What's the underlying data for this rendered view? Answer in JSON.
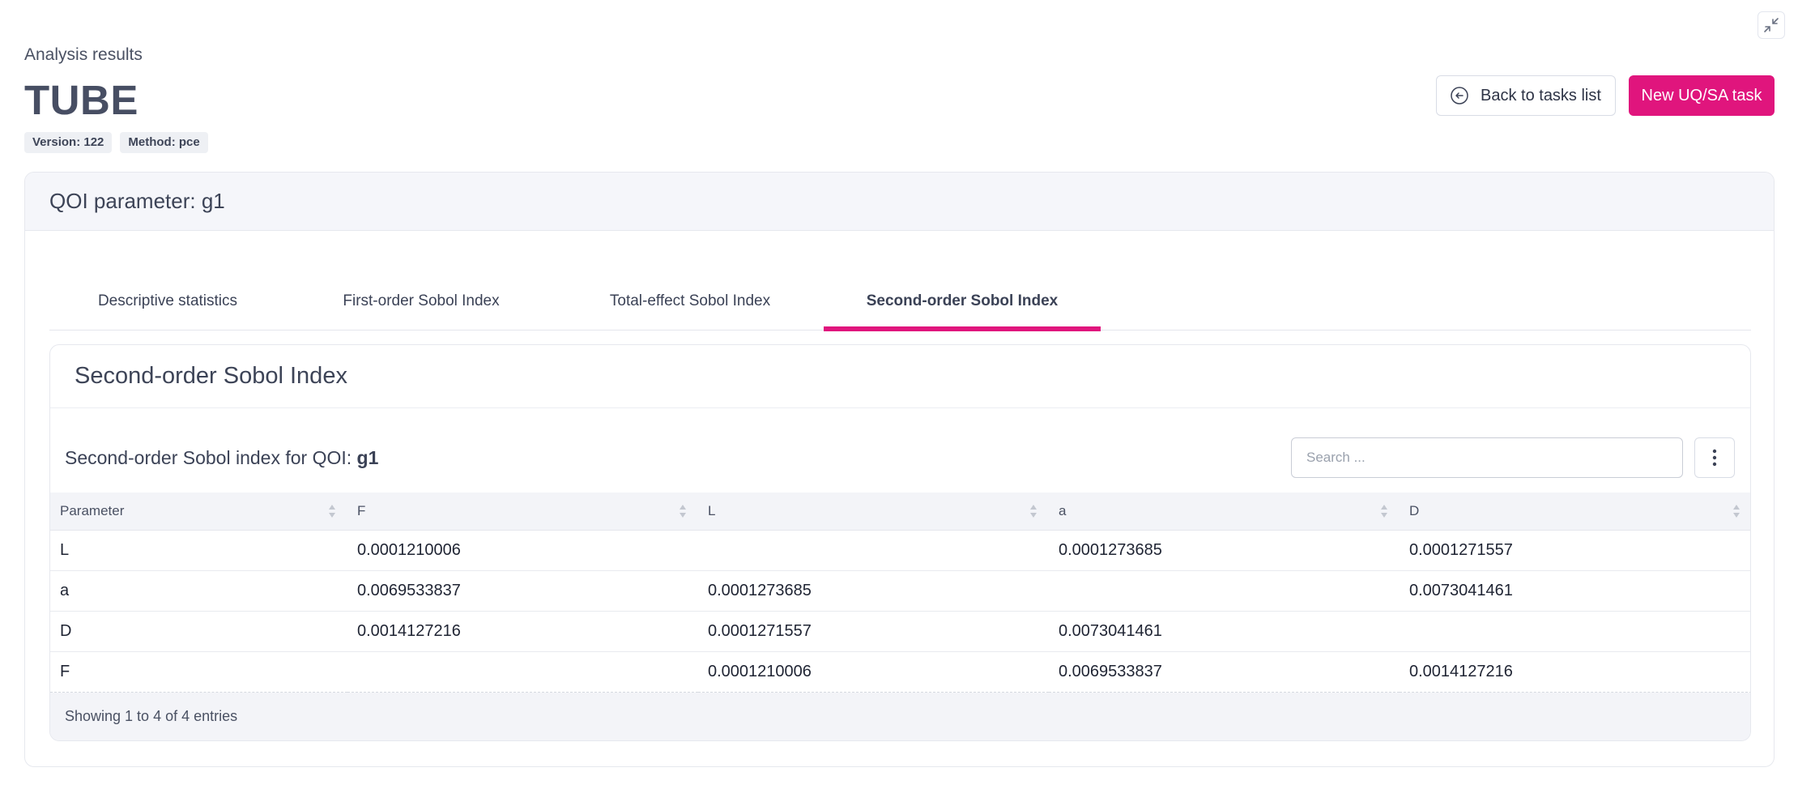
{
  "header": {
    "subtitle": "Analysis results",
    "title": "TUBE",
    "badges": {
      "version": "Version: 122",
      "method": "Method: pce"
    },
    "back_button": "Back to tasks list",
    "new_task_button": "New UQ/SA task"
  },
  "card": {
    "title": "QOI parameter: g1",
    "tabs": [
      {
        "label": "Descriptive statistics",
        "active": false
      },
      {
        "label": "First-order Sobol Index",
        "active": false
      },
      {
        "label": "Total-effect Sobol Index",
        "active": false
      },
      {
        "label": "Second-order Sobol Index",
        "active": true
      }
    ],
    "section_title": "Second-order Sobol Index",
    "table_caption": {
      "prefix": "Second-order Sobol index for QOI: ",
      "qoi": "g1"
    },
    "search_placeholder": "Search ...",
    "table": {
      "columns": [
        "Parameter",
        "F",
        "L",
        "a",
        "D"
      ],
      "rows": [
        [
          "L",
          "0.0001210006",
          "",
          "0.0001273685",
          "0.0001271557"
        ],
        [
          "a",
          "0.0069533837",
          "0.0001273685",
          "",
          "0.0073041461"
        ],
        [
          "D",
          "0.0014127216",
          "0.0001271557",
          "0.0073041461",
          ""
        ],
        [
          "F",
          "",
          "0.0001210006",
          "0.0069533837",
          "0.0014127216"
        ]
      ]
    },
    "footer": "Showing 1 to 4 of 4 entries"
  },
  "colors": {
    "accent": "#e0157d",
    "text": "#3b4256",
    "header_bg": "#f5f6fa"
  },
  "icons": {
    "collapse": "collapse-icon",
    "back": "arrow-left-circle-icon",
    "more": "more-vertical-icon",
    "sort": "sort-icon"
  }
}
